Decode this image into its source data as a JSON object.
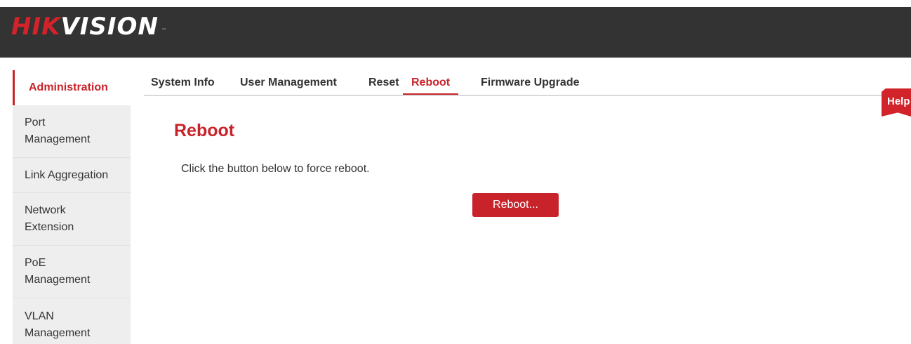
{
  "brand": {
    "logo_red": "HIK",
    "logo_white": "VISION",
    "tm": "™"
  },
  "sidebar": {
    "items": [
      {
        "label": "Administration",
        "active": true
      },
      {
        "label": "Port Management"
      },
      {
        "label": "Link Aggregation"
      },
      {
        "label": "Network Extension"
      },
      {
        "label": "PoE Management"
      },
      {
        "label": "VLAN Management"
      }
    ]
  },
  "tabs": [
    {
      "label": "System Info"
    },
    {
      "label": "User Management"
    },
    {
      "label": "Reset"
    },
    {
      "label": "Reboot",
      "active": true
    },
    {
      "label": "Firmware Upgrade"
    }
  ],
  "help": {
    "label": "Help"
  },
  "main": {
    "title": "Reboot",
    "description": "Click the button below to force reboot.",
    "button_label": "Reboot..."
  },
  "colors": {
    "accent": "#c8232a",
    "header_bg": "#333333",
    "sidebar_bg": "#eeeeee"
  }
}
